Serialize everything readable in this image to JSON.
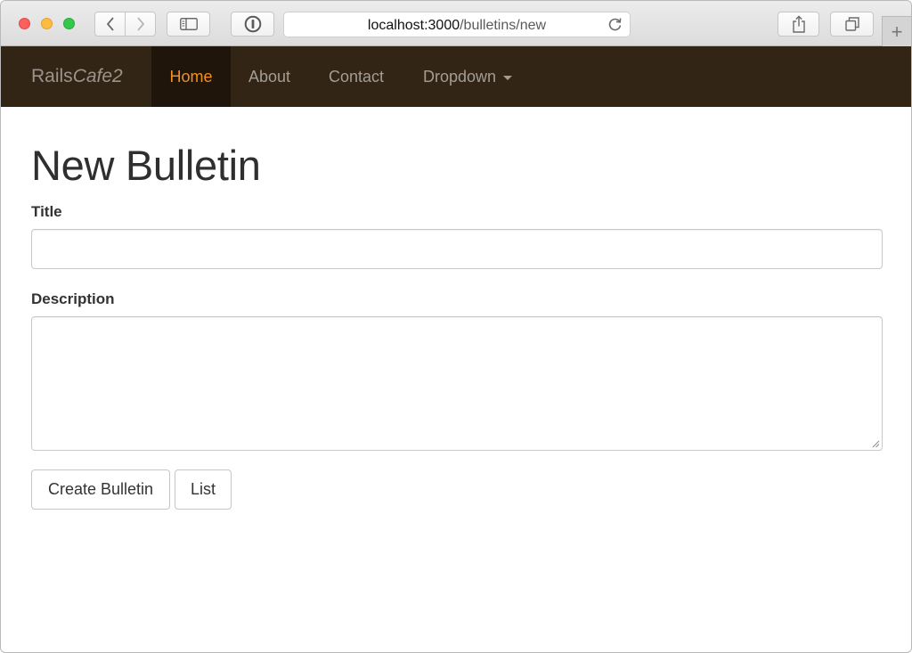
{
  "browser": {
    "url_host": "localhost:3000",
    "url_path": "/bulletins/new",
    "new_tab_glyph": "+"
  },
  "navbar": {
    "brand_plain": "Rails",
    "brand_italic": "Cafe2",
    "items": [
      {
        "label": "Home",
        "active": true
      },
      {
        "label": "About",
        "active": false
      },
      {
        "label": "Contact",
        "active": false
      },
      {
        "label": "Dropdown",
        "active": false,
        "dropdown": true
      }
    ]
  },
  "page": {
    "heading": "New Bulletin",
    "form": {
      "title_label": "Title",
      "title_value": "",
      "description_label": "Description",
      "description_value": "",
      "submit_label": "Create Bulletin",
      "list_label": "List"
    }
  },
  "colors": {
    "navbar_bg": "#332515",
    "navbar_active_bg": "#1f150a",
    "nav_active_text": "#f5901e"
  }
}
